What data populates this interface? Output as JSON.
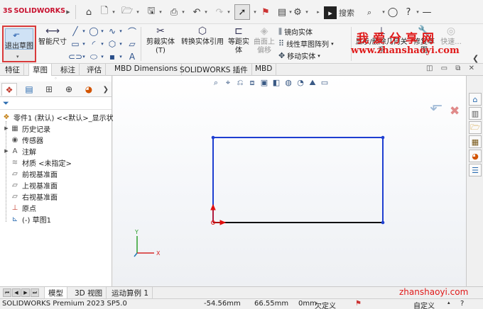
{
  "app": {
    "logo_text": "SOLIDWORKS",
    "logo_mark": "3S"
  },
  "title_bar": {
    "quick_access_icons": [
      "home-icon",
      "new-document-icon",
      "open-folder-icon",
      "save-icon",
      "print-icon",
      "undo-icon",
      "redo-icon",
      "select-pointer-icon",
      "traffic-light-icon",
      "file-properties-icon",
      "options-gear-icon"
    ],
    "search_placeholder": "搜索",
    "help": "?",
    "window_controls": [
      "user-icon",
      "help-icon",
      "minimize-icon"
    ]
  },
  "command_manager": {
    "exit_sketch": "退出草图",
    "smart_dimension": "智能尺寸",
    "trim_entities": "剪裁实体(T)",
    "convert_entities": "转换实体引用",
    "offset_entities": "等距实体",
    "offset_on_surface": "曲面上偏移",
    "mirror_entities": "镜向实体",
    "linear_pattern": "线性草图阵列",
    "move_entities": "移动实体",
    "relations": "显示/删除几何关系",
    "repair_sketch": "修复草图",
    "quick_snaps": "快速..."
  },
  "watermark": {
    "cn": "我爱分享网",
    "url": "www.zhanshaoyi.com",
    "url_short": "zhanshaoyi.com"
  },
  "tabs": [
    "特征",
    "草图",
    "标注",
    "评估",
    "MBD Dimensions",
    "SOLIDWORKS 插件",
    "MBD"
  ],
  "active_tab": "草图",
  "feature_tree": {
    "root": "零件1 (默认) <<默认>_显示状",
    "items": [
      "历史记录",
      "传感器",
      "注解",
      "材质 <未指定>",
      "前视基准面",
      "上视基准面",
      "右视基准面",
      "原点",
      "(-) 草图1"
    ]
  },
  "model_tabs": [
    "模型",
    "3D 视图",
    "运动算例 1"
  ],
  "active_model_tab": "模型",
  "triad": {
    "y": "Y",
    "x": "X"
  },
  "status_bar": {
    "product": "SOLIDWORKS Premium 2023 SP5.0",
    "x_coord": "-54.56mm",
    "y_coord": "66.55mm",
    "z_coord": "0mm",
    "sketch_state": "欠定义",
    "units": "自定义"
  },
  "sketch": {
    "line_color": "#1f3fd1",
    "point_color": "#1f3fd1",
    "origin_color": "#e01010",
    "selected_edge_color": "#111111"
  },
  "colors": {
    "accent_red": "#d93a3a",
    "watermark_red": "#e01a1a"
  }
}
